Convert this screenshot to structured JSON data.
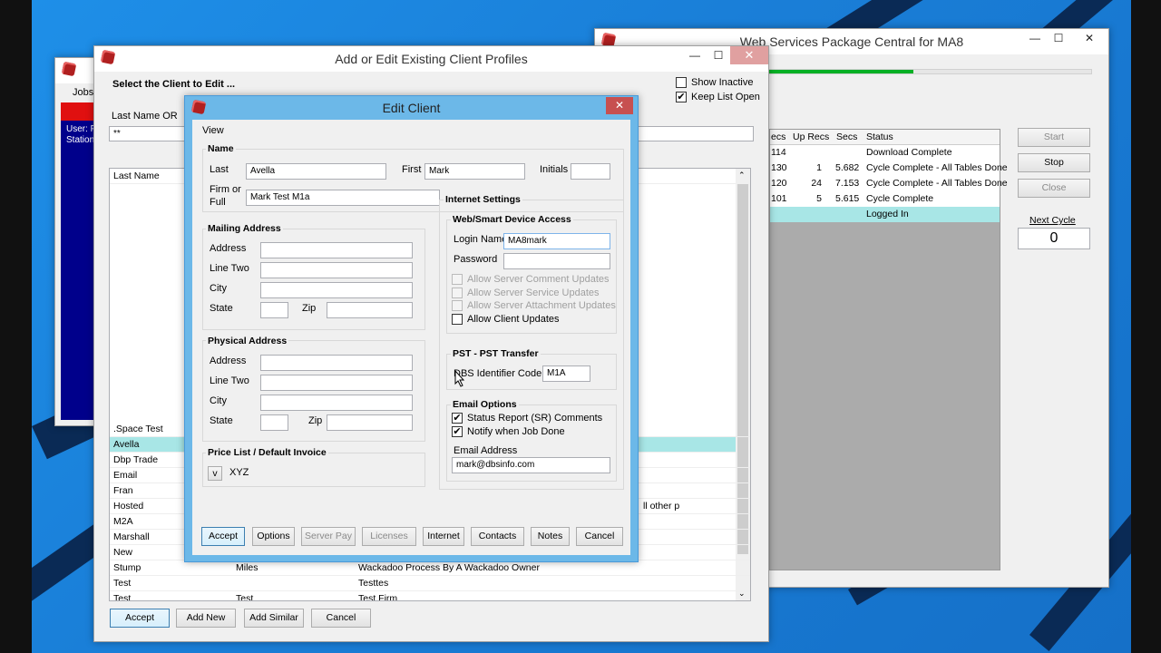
{
  "web_services": {
    "title": "Web Services Package Central for MA8",
    "progress_fraction": 0.45,
    "columns": [
      "ecs",
      "Up Recs",
      "Secs",
      "Status"
    ],
    "rows": [
      {
        "recs": "114",
        "up": "",
        "secs": "",
        "status": "Download Complete"
      },
      {
        "recs": "130",
        "up": "1",
        "secs": "5.682",
        "status": "Cycle Complete - All Tables Done"
      },
      {
        "recs": "120",
        "up": "24",
        "secs": "7.153",
        "status": "Cycle Complete - All Tables Done"
      },
      {
        "recs": "101",
        "up": "5",
        "secs": "5.615",
        "status": "Cycle Complete"
      },
      {
        "recs": "",
        "up": "",
        "secs": "",
        "status": "Logged In"
      }
    ],
    "start_label": "Start",
    "stop_label": "Stop",
    "close_label": "Close",
    "next_cycle_label": "Next Cycle",
    "next_cycle_value": "0"
  },
  "back_window": {
    "jobs_label": "Jobs",
    "user_text": "User: F",
    "station_text": "Station"
  },
  "profiles": {
    "title": "Add or Edit Existing Client Profiles",
    "select_label": "Select the Client to Edit ...",
    "last_name_or_label": "Last Name OR",
    "search_value": "**",
    "show_inactive_label": "Show Inactive",
    "keep_list_open_label": "Keep List Open",
    "column_last_name": "Last Name",
    "clients": [
      {
        "last": ".Space Test",
        "first": "",
        "firm": ""
      },
      {
        "last": "Avella",
        "first": "",
        "firm": ""
      },
      {
        "last": "Dbp Trade",
        "first": "",
        "firm": ""
      },
      {
        "last": "Email",
        "first": "",
        "firm": ""
      },
      {
        "last": "Fran",
        "first": "",
        "firm": ""
      },
      {
        "last": "Hosted",
        "first": "",
        "firm": "ll other p"
      },
      {
        "last": "M2A",
        "first": "",
        "firm": ""
      },
      {
        "last": "Marshall",
        "first": "",
        "firm": ""
      },
      {
        "last": "New",
        "first": "",
        "firm": ""
      },
      {
        "last": "Stump",
        "first": "Miles",
        "firm": "Wackadoo Process By A Wackadoo Owner"
      },
      {
        "last": "Test",
        "first": "",
        "firm": "Testtes"
      },
      {
        "last": "Test",
        "first": "Test",
        "firm": "Test Firm"
      }
    ],
    "accept_label": "Accept",
    "add_new_label": "Add New",
    "add_similar_label": "Add Similar",
    "cancel_label": "Cancel"
  },
  "edit_client": {
    "title": "Edit Client",
    "menu_view": "View",
    "name_group": "Name",
    "last_label": "Last",
    "last_value": "Avella",
    "first_label": "First",
    "first_value": "Mark",
    "initials_label": "Initials",
    "initials_value": "",
    "firm_label_1": "Firm or",
    "firm_label_2": "Full",
    "firm_value": "Mark Test M1a",
    "mailing_group": "Mailing Address",
    "physical_group": "Physical Address",
    "address_label": "Address",
    "line_two_label": "Line Two",
    "city_label": "City",
    "state_label": "State",
    "zip_label": "Zip",
    "price_group": "Price List / Default Invoice",
    "price_dropdown": "v",
    "price_value": "XYZ",
    "internet_group": "Internet Settings",
    "web_access_group": "Web/Smart Device Access",
    "login_label": "Login Name",
    "login_value": "MA8mark",
    "password_label": "Password",
    "allow_comment": "Allow Server Comment Updates",
    "allow_service": "Allow Server Service Updates",
    "allow_attachment": "Allow Server Attachment Updates",
    "allow_client": "Allow Client Updates",
    "pst_group": "PST - PST Transfer",
    "dbs_label": "DBS Identifier Code",
    "dbs_value": "M1A",
    "email_group": "Email Options",
    "status_report_label": "Status Report (SR) Comments",
    "notify_label": "Notify when Job Done",
    "email_address_label": "Email Address",
    "email_value": "mark@dbsinfo.com",
    "check_mark": "✔",
    "buttons": {
      "accept": "Accept",
      "options": "Options",
      "server_pay": "Server Pay",
      "licenses": "Licenses",
      "internet": "Internet",
      "contacts": "Contacts",
      "notes": "Notes",
      "cancel": "Cancel"
    }
  },
  "window_controls": {
    "minimize": "—",
    "maximize": "☐",
    "close": "✕"
  }
}
